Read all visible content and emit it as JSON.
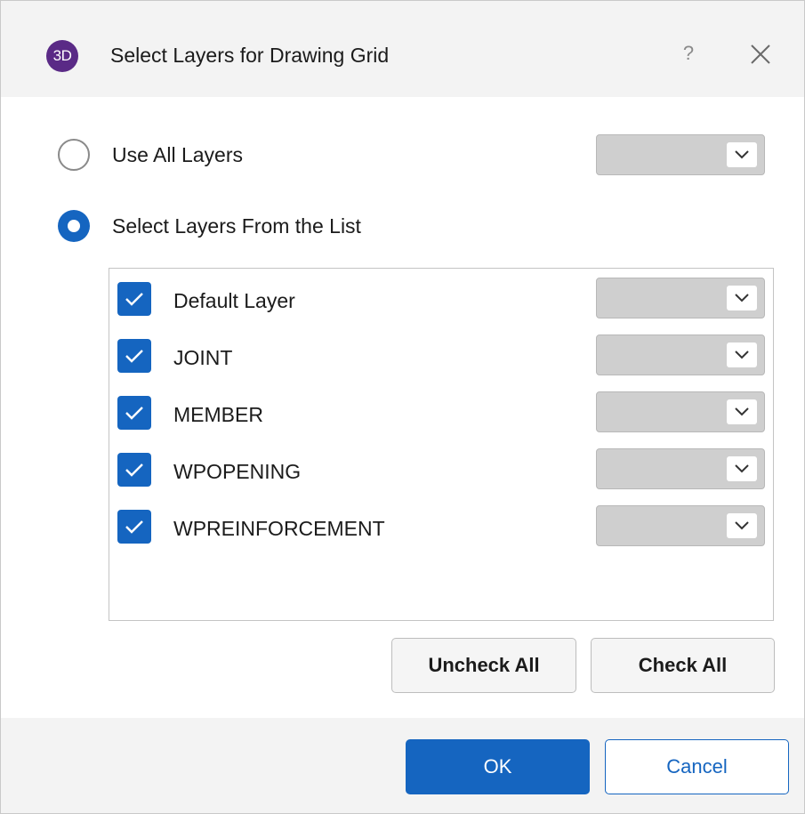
{
  "titlebar": {
    "app_badge": "3D",
    "title": "Select Layers for Drawing Grid",
    "help": "?"
  },
  "options": {
    "use_all": {
      "label": "Use All Layers",
      "selected": false
    },
    "select_from_list": {
      "label": "Select Layers From the List",
      "selected": true
    }
  },
  "layers": [
    {
      "label": "Default Layer",
      "checked": true
    },
    {
      "label": "JOINT",
      "checked": true
    },
    {
      "label": "MEMBER",
      "checked": true
    },
    {
      "label": "WPOPENING",
      "checked": true
    },
    {
      "label": "WPREINFORCEMENT",
      "checked": true
    }
  ],
  "buttons": {
    "uncheck_all": "Uncheck All",
    "check_all": "Check All",
    "ok": "OK",
    "cancel": "Cancel"
  },
  "colors": {
    "accent": "#1565c0",
    "badge": "#5a2a86",
    "combo_disabled": "#cfcfcf"
  }
}
